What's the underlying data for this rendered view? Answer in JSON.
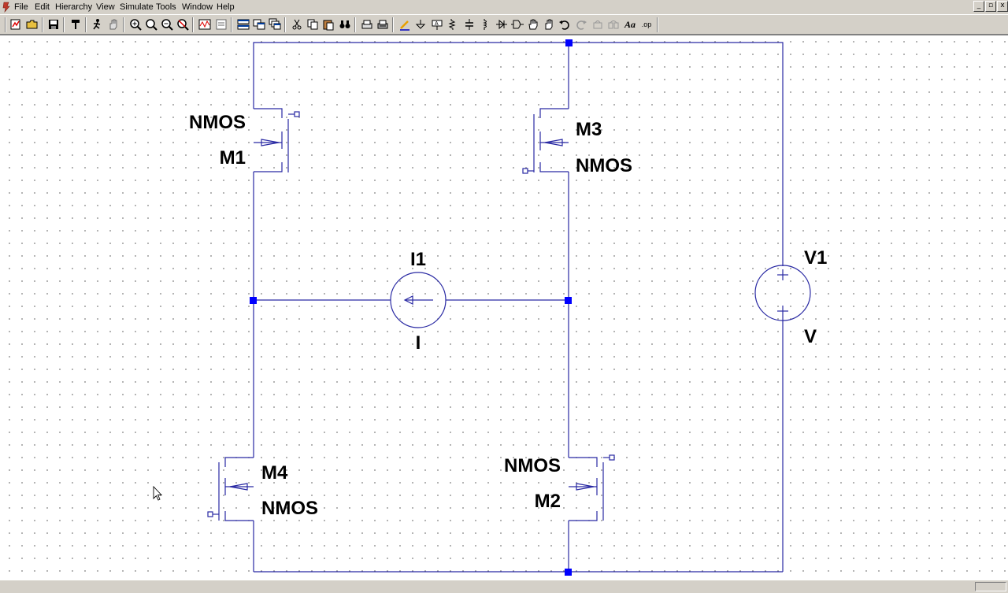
{
  "menu": {
    "file": "File",
    "edit": "Edit",
    "hierarchy": "Hierarchy",
    "view": "View",
    "simulate": "Simulate",
    "tools": "Tools",
    "window": "Window",
    "help": "Help"
  },
  "window_controls": {
    "minimize": "_",
    "restore": "▫",
    "close": "x"
  },
  "toolbar": {
    "label_tool": "Aa",
    "spice_directive": ".op"
  },
  "schematic": {
    "M1": {
      "name": "M1",
      "model": "NMOS"
    },
    "M2": {
      "name": "M2",
      "model": "NMOS"
    },
    "M3": {
      "name": "M3",
      "model": "NMOS"
    },
    "M4": {
      "name": "M4",
      "model": "NMOS"
    },
    "I1": {
      "name": "I1",
      "value": "I"
    },
    "V1": {
      "name": "V1",
      "value": "V"
    }
  },
  "colors": {
    "wire": "#2929a3",
    "component": "#2929a3",
    "junction": "#0000ff",
    "label": "#000000"
  }
}
